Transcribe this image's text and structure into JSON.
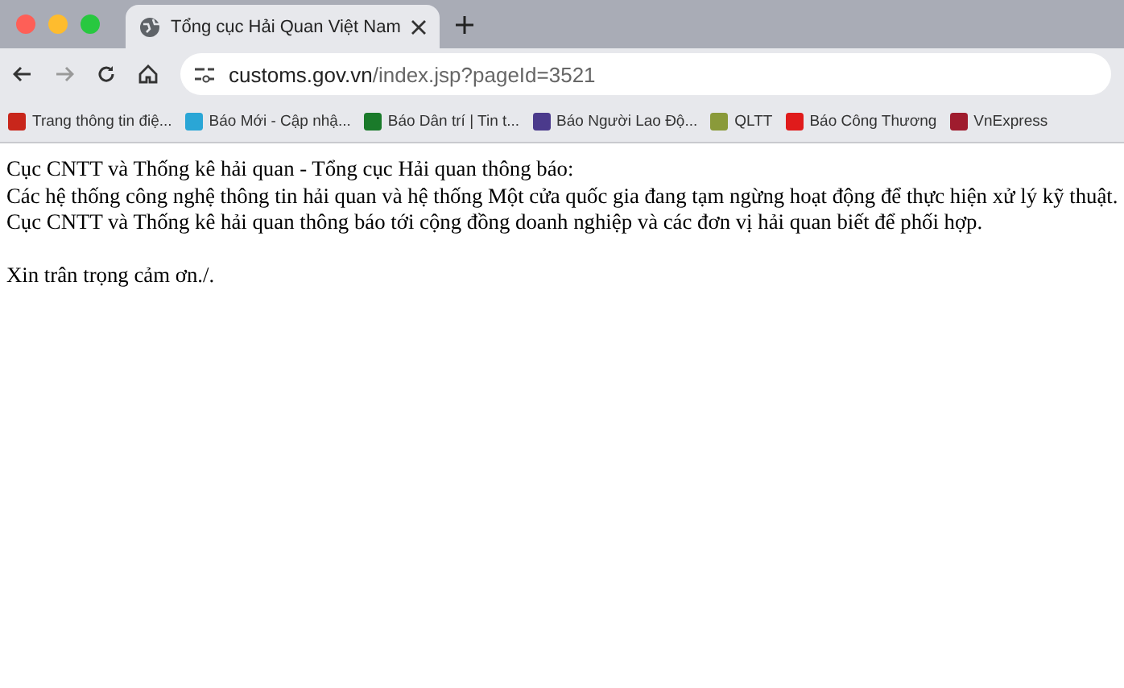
{
  "tab": {
    "title": "Tổng cục Hải Quan Việt Nam",
    "selected": true
  },
  "address": {
    "host": "customs.gov.vn",
    "path": "/index.jsp?pageId=3521"
  },
  "bookmarks": [
    {
      "label": "Trang thông tin điệ...",
      "color": "#c8261b"
    },
    {
      "label": "Báo Mới - Cập nhậ...",
      "color": "#2aa6d6"
    },
    {
      "label": "Báo Dân trí | Tin t...",
      "color": "#1a7a2a"
    },
    {
      "label": "Báo Người Lao Độ...",
      "color": "#4b3a8c"
    },
    {
      "label": "QLTT",
      "color": "#8a9a3a"
    },
    {
      "label": "Báo Công Thương",
      "color": "#e01b1b"
    },
    {
      "label": "VnExpress",
      "color": "#9f1c2e"
    }
  ],
  "paragraphs": [
    [
      "Cục CNTT và Thống kê hải quan - Tổng cục Hải quan thông báo:",
      "Các hệ thống công nghệ thông tin hải quan và hệ thống Một cửa quốc gia đang tạm ngừng hoạt động để thực hiện xử lý kỹ thuật.",
      "Cục CNTT và Thống kê hải quan thông báo tới cộng đồng doanh nghiệp và các đơn vị hải quan biết để phối hợp."
    ],
    [
      "Xin trân trọng cảm ơn./."
    ]
  ]
}
